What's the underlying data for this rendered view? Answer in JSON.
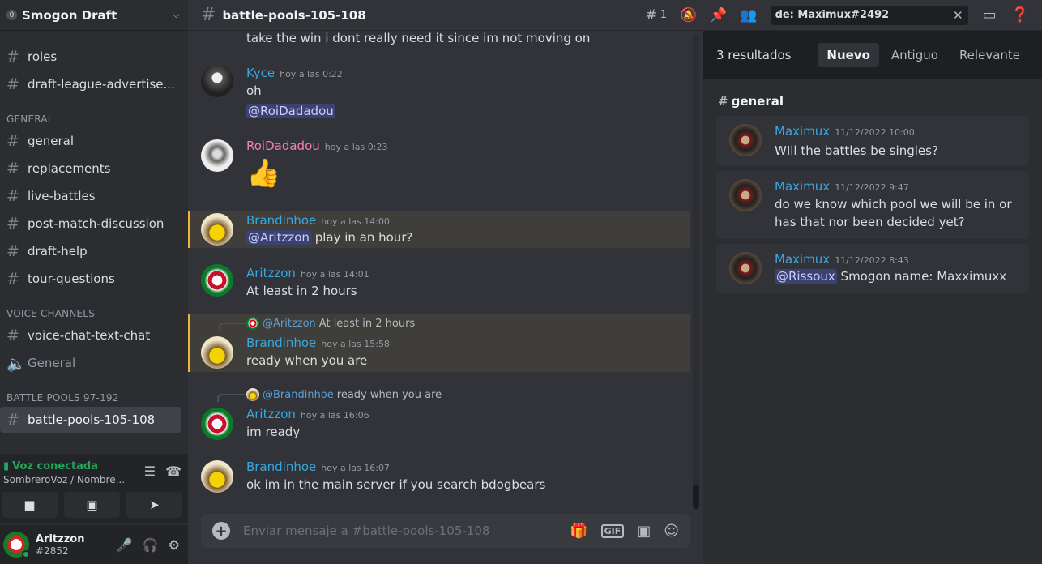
{
  "sidebar": {
    "server_name": "Smogon Draft",
    "channels_top": [
      "roles",
      "draft-league-advertise..."
    ],
    "cat_general": "GENERAL",
    "general_channels": [
      "general",
      "replacements",
      "live-battles",
      "post-match-discussion",
      "draft-help",
      "tour-questions"
    ],
    "cat_voice": "VOICE CHANNELS",
    "voice_text": "voice-chat-text-chat",
    "voice_general": "General",
    "cat_battle": "BATTLE POOLS 97-192",
    "active_channel": "battle-pools-105-108"
  },
  "voice": {
    "status": "Voz conectada",
    "sub": "SombreroVoz / Nombre..."
  },
  "user": {
    "name": "Aritzzon",
    "tag": "#2852"
  },
  "topbar": {
    "channel": "battle-pools-105-108",
    "threads_count": "1",
    "search_value": "de: Maximux#2492"
  },
  "messages": {
    "cut_text": "take the win i dont really need it since im not moving on",
    "m1": {
      "author": "Kyce",
      "time": "hoy a las 0:22",
      "text": "oh",
      "mention": "@RoiDadadou",
      "color": "#38a7e0"
    },
    "m2": {
      "author": "RoiDadadou",
      "time": "hoy a las 0:23",
      "color": "#f47fb8"
    },
    "m3": {
      "author": "Brandinhoe",
      "time": "hoy a las 14:00",
      "mention": "@Aritzzon",
      "text": " play in an hour?",
      "color": "#38a7e0"
    },
    "m4": {
      "author": "Aritzzon",
      "time": "hoy a las 14:01",
      "text": "At least in 2 hours",
      "color": "#38a7e0"
    },
    "m5": {
      "reply_name": "@Aritzzon",
      "reply_text": "At least in 2 hours",
      "author": "Brandinhoe",
      "time": "hoy a las 15:58",
      "text": "ready when you are"
    },
    "m6": {
      "reply_name": "@Brandinhoe",
      "reply_text": "ready when you are",
      "author": "Aritzzon",
      "time": "hoy a las 16:06",
      "text": "im ready"
    },
    "m7": {
      "author": "Brandinhoe",
      "time": "hoy a las 16:07",
      "text": "ok im in the main server if you search bdogbears"
    }
  },
  "composer": {
    "placeholder": "Enviar mensaje a #battle-pools-105-108",
    "gif": "GIF"
  },
  "results": {
    "count": "3 resultados",
    "sort": [
      "Nuevo",
      "Antiguo",
      "Relevante"
    ],
    "channel": "general",
    "items": [
      {
        "author": "Maximux",
        "time": "11/12/2022 10:00",
        "text": "WIll the battles be singles?"
      },
      {
        "author": "Maximux",
        "time": "11/12/2022 9:47",
        "text": "do we know which pool we will be in or has that nor been decided yet?"
      },
      {
        "author": "Maximux",
        "time": "11/12/2022 8:43",
        "mention": "@Rissoux",
        "text": " Smogon name: Maxximuxx"
      }
    ]
  },
  "colors": {
    "accent": "#5865f2",
    "link_name": "#38a7e0",
    "green": "#23a55a"
  }
}
